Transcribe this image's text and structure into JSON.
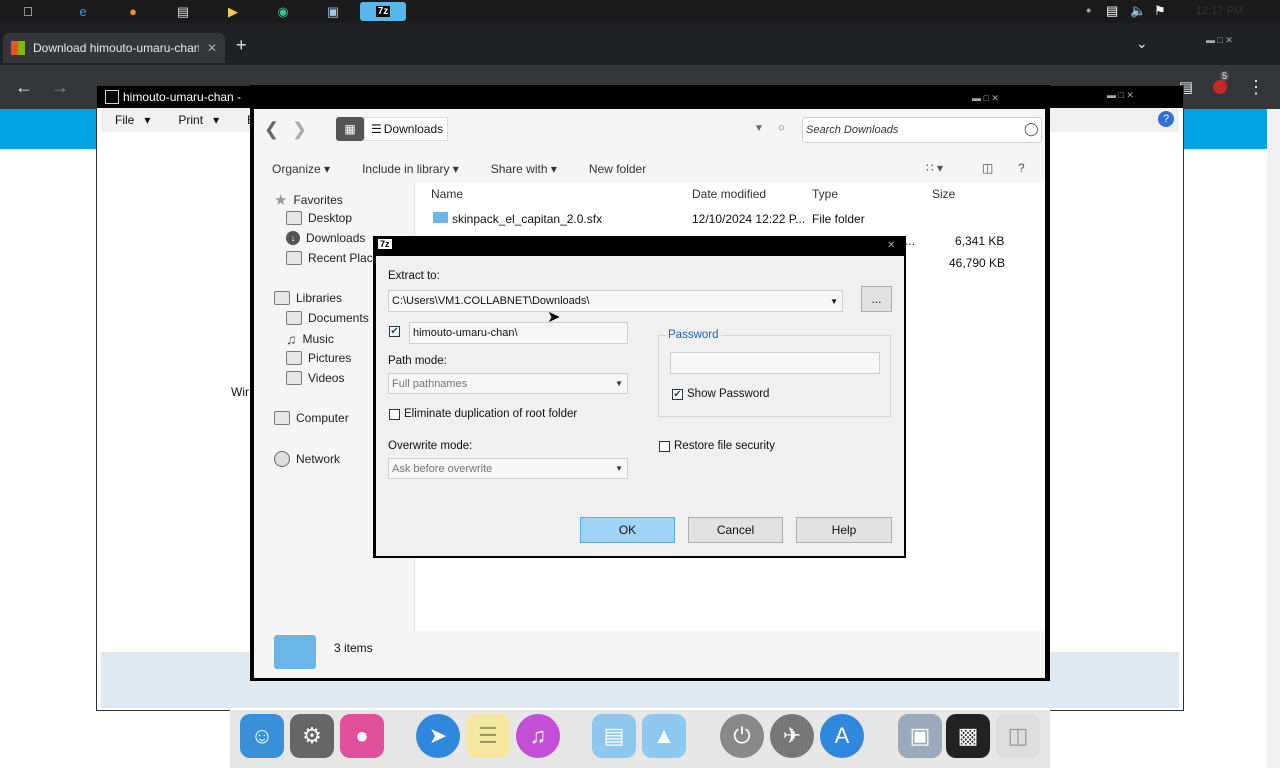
{
  "taskbar": {
    "icons": [
      "apple-icon",
      "ie-icon",
      "firefox-icon",
      "notepad-icon",
      "media-icon",
      "edge-icon",
      "screen-icon",
      "7zip-icon"
    ],
    "active_label": "7z",
    "clock": "12:17 PM"
  },
  "browser": {
    "tab_title": "Download himouto-umaru-chan.p",
    "new_tab": "+",
    "extension_badge": "5"
  },
  "viewer": {
    "title": "himouto-umaru-chan - ",
    "menu": [
      {
        "label": "File"
      },
      {
        "label": "Print"
      },
      {
        "label": "E"
      }
    ],
    "side_text": "Wir"
  },
  "explorer": {
    "breadcrumb": "Downloads",
    "search_placeholder": "Search Downloads",
    "commands": [
      "Organize",
      "Include in library",
      "Share with",
      "New folder"
    ],
    "sidebar": [
      {
        "label": "Favorites",
        "icon": "star-icon",
        "sub": false
      },
      {
        "label": "Desktop",
        "icon": "desktop-icon",
        "sub": true
      },
      {
        "label": "Downloads",
        "icon": "downloads-icon",
        "sub": true
      },
      {
        "label": "Recent Places",
        "icon": "recent-places-icon",
        "sub": true
      },
      {
        "label": "Libraries",
        "icon": "libraries-icon",
        "sub": false
      },
      {
        "label": "Documents",
        "icon": "documents-icon",
        "sub": true
      },
      {
        "label": "Music",
        "icon": "music-icon",
        "sub": true
      },
      {
        "label": "Pictures",
        "icon": "pictures-icon",
        "sub": true
      },
      {
        "label": "Videos",
        "icon": "videos-icon",
        "sub": true
      },
      {
        "label": "Computer",
        "icon": "computer-icon",
        "sub": false
      },
      {
        "label": "Network",
        "icon": "network-icon",
        "sub": false
      }
    ],
    "columns": [
      "Name",
      "Date modified",
      "Type",
      "Size"
    ],
    "rows": [
      {
        "name": "skinpack_el_capitan_2.0.sfx",
        "date": "12/10/2024 12:22 P...",
        "type": "File folder",
        "size": ""
      },
      {
        "name": "",
        "date": "",
        "type": "...",
        "size": "6,341 KB"
      },
      {
        "name": "",
        "date": "",
        "type": "",
        "size": "46,790 KB"
      }
    ],
    "status": "3 items"
  },
  "dialog": {
    "title_icon": "7z",
    "extract_to_label": "Extract to:",
    "extract_to_value": "C:\\Users\\VM1.COLLABNET\\Downloads\\",
    "browse_label": "...",
    "subfolder_value": "himouto-umaru-chan\\",
    "subfolder_checked": true,
    "path_mode_label": "Path mode:",
    "path_mode_value": "Full pathnames",
    "eliminate_label": "Eliminate duplication of root folder",
    "eliminate_checked": false,
    "overwrite_label": "Overwrite mode:",
    "overwrite_value": "Ask before overwrite",
    "password_group": "Password",
    "password_value": "",
    "show_password_label": "Show Password",
    "show_password_checked": true,
    "restore_security_label": "Restore file security",
    "restore_security_checked": false,
    "ok_label": "OK",
    "cancel_label": "Cancel",
    "help_label": "Help"
  },
  "dock": {
    "items": [
      "finder-icon",
      "system-preferences-icon",
      "game-center-icon",
      "safari-icon",
      "notes-icon",
      "itunes-icon",
      "folder-icon",
      "applications-folder-icon",
      "power-icon",
      "launchpad-icon",
      "app-store-icon",
      "preview-icon",
      "photo-booth-icon",
      "trash-icon"
    ]
  },
  "colors": {
    "accent": "#03a2e3",
    "ok_button": "#9fd3f7",
    "tab_bg": "#35363a"
  }
}
